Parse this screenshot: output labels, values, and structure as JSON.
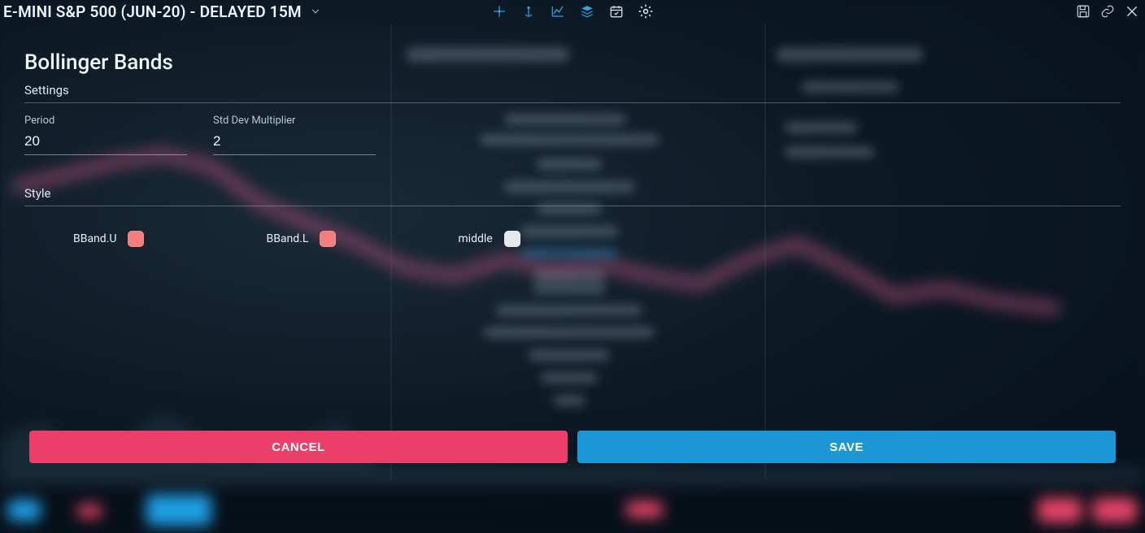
{
  "header": {
    "title": "E-MINI S&P 500 (JUN-20) - DELAYED 15M"
  },
  "modal": {
    "title": "Bollinger Bands",
    "sections": {
      "settings": "Settings",
      "style": "Style"
    },
    "fields": {
      "period": {
        "label": "Period",
        "value": "20"
      },
      "std_dev": {
        "label": "Std Dev Multiplier",
        "value": "2"
      }
    },
    "styles": [
      {
        "label": "BBand.U",
        "color": "#f47d7d",
        "css": "background:#f47d7d"
      },
      {
        "label": "BBand.L",
        "color": "#f47d7d",
        "css": "background:#f47d7d"
      },
      {
        "label": "middle",
        "color": "#e5e9ec",
        "css": "background:#e5e9ec"
      }
    ],
    "buttons": {
      "cancel": "CANCEL",
      "save": "SAVE"
    }
  },
  "colors": {
    "accent_blue": "#1a97d4",
    "accent_red": "#eb3f6a",
    "icon_blue": "#28a8e0",
    "text": "#e6eff5",
    "bg": "#0a1520"
  }
}
